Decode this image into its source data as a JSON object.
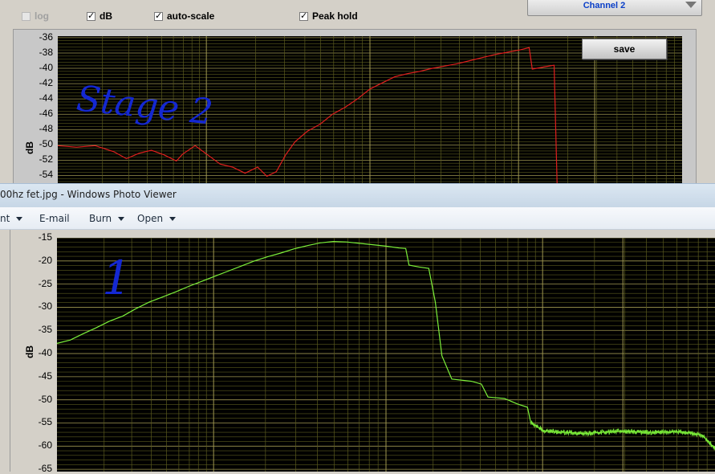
{
  "analyzer": {
    "checkboxes": [
      {
        "label": "log",
        "checked": false,
        "disabled": true
      },
      {
        "label": "dB",
        "checked": true,
        "disabled": false
      },
      {
        "label": "auto-scale",
        "checked": true,
        "disabled": false
      },
      {
        "label": "Peak hold",
        "checked": true,
        "disabled": false
      }
    ],
    "channel_select": {
      "value": "Channel 2"
    },
    "save_label": "save",
    "annotation_top": "Stage 2",
    "annotation_bottom": "1"
  },
  "photo_viewer": {
    "title": "00hz fet.jpg - Windows Photo Viewer",
    "menu": [
      {
        "label": "nt",
        "has_caret": true
      },
      {
        "label": "E-mail",
        "has_caret": false
      },
      {
        "label": "Burn",
        "has_caret": true
      },
      {
        "label": "Open",
        "has_caret": true
      }
    ]
  },
  "colors": {
    "top_trace": "#e01e1e",
    "bottom_trace": "#7cf03a",
    "minor_grid": "#5a5a1e",
    "major_grid": "#9e9650",
    "annotation_ink": "#1428d2"
  },
  "chart_data": [
    {
      "type": "line",
      "ylabel": "dB",
      "yticks": [
        -36,
        -38,
        -40,
        -42,
        -44,
        -46,
        -48,
        -50,
        -52,
        -54
      ],
      "ylim": [
        -55,
        -35.8
      ],
      "grid": true,
      "series": [
        {
          "points": [
            [
              0,
              -50.1
            ],
            [
              0.03,
              -50.3
            ],
            [
              0.06,
              -50.1
            ],
            [
              0.09,
              -50.9
            ],
            [
              0.11,
              -51.8
            ],
            [
              0.13,
              -51.1
            ],
            [
              0.15,
              -50.7
            ],
            [
              0.17,
              -51.3
            ],
            [
              0.19,
              -52.1
            ],
            [
              0.2,
              -51.2
            ],
            [
              0.22,
              -50.1
            ],
            [
              0.24,
              -51.3
            ],
            [
              0.26,
              -52.5
            ],
            [
              0.28,
              -52.9
            ],
            [
              0.3,
              -53.7
            ],
            [
              0.32,
              -52.9
            ],
            [
              0.335,
              -54.1
            ],
            [
              0.35,
              -53.5
            ],
            [
              0.365,
              -51.3
            ],
            [
              0.38,
              -49.6
            ],
            [
              0.4,
              -48.2
            ],
            [
              0.42,
              -47.3
            ],
            [
              0.44,
              -46.0
            ],
            [
              0.46,
              -45.1
            ],
            [
              0.48,
              -44.0
            ],
            [
              0.5,
              -42.7
            ],
            [
              0.52,
              -41.9
            ],
            [
              0.54,
              -41.1
            ],
            [
              0.56,
              -40.7
            ],
            [
              0.58,
              -40.4
            ],
            [
              0.6,
              -40.0
            ],
            [
              0.62,
              -39.7
            ],
            [
              0.64,
              -39.4
            ],
            [
              0.66,
              -39.0
            ],
            [
              0.68,
              -38.6
            ],
            [
              0.7,
              -38.2
            ],
            [
              0.72,
              -37.9
            ],
            [
              0.74,
              -37.6
            ],
            [
              0.755,
              -37.3
            ],
            [
              0.76,
              -40.1
            ],
            [
              0.78,
              -39.8
            ],
            [
              0.795,
              -39.6
            ],
            [
              0.8,
              -55.8
            ],
            [
              1,
              -56
            ]
          ]
        }
      ]
    },
    {
      "type": "line",
      "ylabel": "dB",
      "yticks": [
        -15,
        -20,
        -25,
        -30,
        -35,
        -40,
        -45,
        -50,
        -55,
        -60,
        -65
      ],
      "ylim": [
        -65.5,
        -15
      ],
      "grid": true,
      "series": [
        {
          "points": [
            [
              0,
              -37.8
            ],
            [
              0.02,
              -37.1
            ],
            [
              0.04,
              -35.7
            ],
            [
              0.06,
              -34.4
            ],
            [
              0.08,
              -33.0
            ],
            [
              0.1,
              -31.9
            ],
            [
              0.12,
              -30.3
            ],
            [
              0.14,
              -28.9
            ],
            [
              0.16,
              -27.8
            ],
            [
              0.18,
              -26.7
            ],
            [
              0.2,
              -25.5
            ],
            [
              0.22,
              -24.4
            ],
            [
              0.24,
              -23.3
            ],
            [
              0.26,
              -22.2
            ],
            [
              0.28,
              -21.1
            ],
            [
              0.3,
              -20.0
            ],
            [
              0.32,
              -19.1
            ],
            [
              0.34,
              -18.3
            ],
            [
              0.36,
              -17.4
            ],
            [
              0.38,
              -16.7
            ],
            [
              0.4,
              -16.1
            ],
            [
              0.42,
              -15.8
            ],
            [
              0.44,
              -15.9
            ],
            [
              0.46,
              -16.2
            ],
            [
              0.48,
              -16.5
            ],
            [
              0.5,
              -16.8
            ],
            [
              0.52,
              -17.2
            ],
            [
              0.53,
              -17.3
            ],
            [
              0.535,
              -20.9
            ],
            [
              0.55,
              -21.3
            ],
            [
              0.565,
              -21.6
            ],
            [
              0.575,
              -28.9
            ],
            [
              0.585,
              -40.5
            ],
            [
              0.6,
              -45.5
            ],
            [
              0.63,
              -46.0
            ],
            [
              0.645,
              -46.6
            ],
            [
              0.655,
              -49.4
            ],
            [
              0.68,
              -49.7
            ],
            [
              0.7,
              -50.9
            ],
            [
              0.715,
              -51.6
            ],
            [
              0.72,
              -54.9
            ],
            [
              0.74,
              -56.7
            ],
            [
              0.8,
              -57.3
            ],
            [
              0.85,
              -56.8
            ],
            [
              0.9,
              -57.0
            ],
            [
              0.95,
              -56.9
            ],
            [
              0.98,
              -57.6
            ],
            [
              1,
              -60.5
            ]
          ]
        }
      ]
    }
  ]
}
